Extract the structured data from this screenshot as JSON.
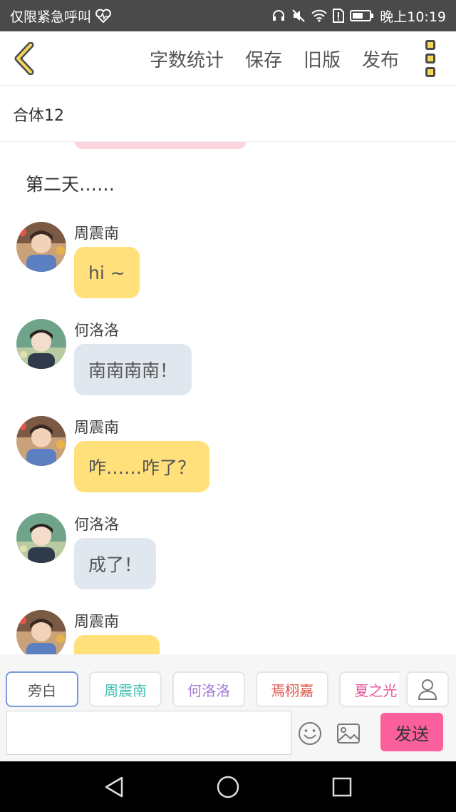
{
  "statusbar": {
    "left_text": "仅限紧急呼叫",
    "time": "晚上10:19"
  },
  "toolbar": {
    "word_count": "字数统计",
    "save": "保存",
    "old_version": "旧版",
    "publish": "发布"
  },
  "story": {
    "title": "合体12"
  },
  "narration": "第二天……",
  "messages": [
    {
      "sender": "周震南",
      "text": "hi ~",
      "style": "yellow"
    },
    {
      "sender": "何洛洛",
      "text": "南南南南！",
      "style": "gray"
    },
    {
      "sender": "周震南",
      "text": "咋……咋了？",
      "style": "yellow"
    },
    {
      "sender": "何洛洛",
      "text": "成了！",
      "style": "gray"
    },
    {
      "sender": "周震南",
      "text": "",
      "style": "yellow"
    }
  ],
  "characters": [
    {
      "name": "旁白",
      "color": "#555555"
    },
    {
      "name": "周震南",
      "color": "#3fbfb0"
    },
    {
      "name": "何洛洛",
      "color": "#a57bd6"
    },
    {
      "name": "焉栩嘉",
      "color": "#e0554f"
    },
    {
      "name": "夏之光",
      "color": "#e8569a"
    }
  ],
  "composer": {
    "send_label": "发送",
    "placeholder": ""
  },
  "colors": {
    "yellow_bubble": "#ffe07a",
    "gray_bubble": "#e1e7ef",
    "send_button": "#fb5f9c",
    "accent": "#f5d85a"
  }
}
